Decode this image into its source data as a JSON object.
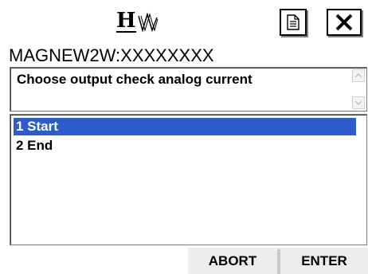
{
  "logo": {
    "letter": "H",
    "icon": "hw-waveform-logo"
  },
  "toolbar": {
    "doc_icon": "document-icon",
    "close_icon": "close-icon"
  },
  "title": "MAGNEW2W:XXXXXXXX",
  "message": {
    "text": "Choose output check analog current"
  },
  "options": [
    {
      "label": "1 Start",
      "selected": true
    },
    {
      "label": "2 End",
      "selected": false
    }
  ],
  "buttons": {
    "abort": "ABORT",
    "enter": "ENTER"
  },
  "colors": {
    "selection": "#2d5ccb"
  }
}
